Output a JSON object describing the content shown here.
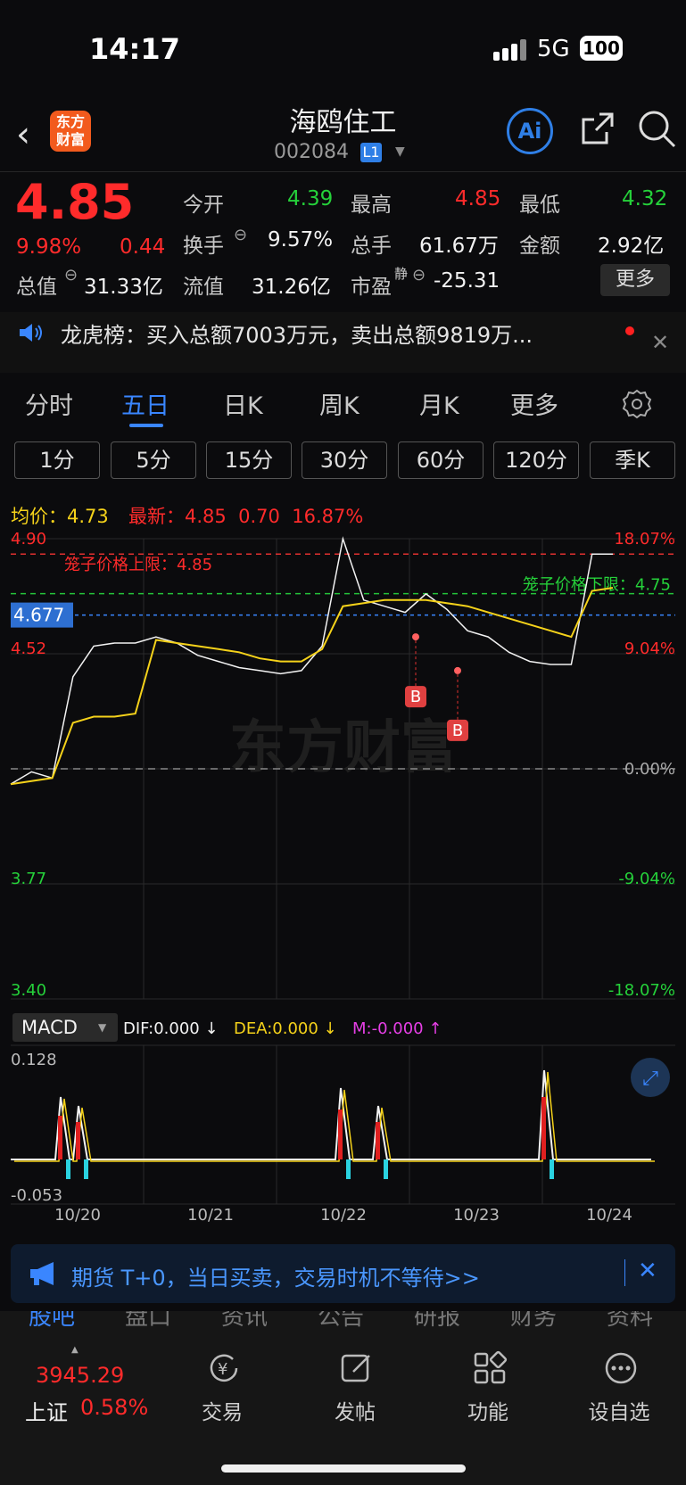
{
  "status_bar": {
    "time": "14:17",
    "network": "5G",
    "battery": "100"
  },
  "header": {
    "name": "海鸥住工",
    "code": "002084",
    "level_badge": "L1",
    "logo_text": "东方财富",
    "ai_label": "Ai"
  },
  "quote": {
    "price": "4.85",
    "change_pct": "9.98%",
    "change": "0.44",
    "open_label": "今开",
    "open": "4.39",
    "high_label": "最高",
    "high": "4.85",
    "low_label": "最低",
    "low": "4.32",
    "turnover_label": "换手",
    "turnover": "9.57%",
    "volume_label": "总手",
    "volume": "61.67万",
    "amount_label": "金额",
    "amount": "2.92亿",
    "mktcap_label": "总值",
    "mktcap": "31.33亿",
    "float_label": "流值",
    "float": "31.26亿",
    "pe_label": "市盈",
    "pe_sup": "静",
    "pe": "-25.31",
    "more_label": "更多"
  },
  "news": {
    "text": "龙虎榜：买入总额7003万元，卖出总额9819万..."
  },
  "tabs": {
    "t1": "分时",
    "t2": "五日",
    "t3": "日K",
    "t4": "周K",
    "t5": "月K",
    "t6": "更多",
    "active": "五日"
  },
  "periods": {
    "p1": "1分",
    "p2": "5分",
    "p3": "15分",
    "p4": "30分",
    "p5": "60分",
    "p6": "120分",
    "p7": "季K"
  },
  "chart_info": {
    "avg_label": "均价：",
    "avg": "4.73",
    "latest_label": "最新：",
    "latest": "4.85",
    "chg": "0.70",
    "chg_pct": "16.87%"
  },
  "cage": {
    "upper": "笼子价格上限：4.85",
    "lower": "笼子价格下限：4.75",
    "cursor": "4.677",
    "buy_marker": "B"
  },
  "watermark": "东方财富",
  "macd": {
    "label": "MACD",
    "dif": "DIF:0.000 ↓",
    "dea": "DEA:0.000 ↓",
    "m": "M:-0.000 ↑",
    "ymax": "0.128",
    "ymin": "-0.053"
  },
  "chart_data": {
    "type": "line",
    "x": [
      "10/20",
      "10/21",
      "10/22",
      "10/23",
      "10/24"
    ],
    "y_left_ticks": [
      "4.90",
      "4.52",
      "3.77",
      "3.40"
    ],
    "y_right_ticks": [
      "18.07%",
      "9.04%",
      "0.00%",
      "-9.04%",
      "-18.07%"
    ],
    "ylim": [
      3.4,
      4.9
    ],
    "series": [
      {
        "values": [
          4.1,
          4.14,
          4.12,
          4.45,
          4.55,
          4.56,
          4.56,
          4.58,
          4.56,
          4.52,
          4.5,
          4.48,
          4.47,
          4.46,
          4.47,
          4.55,
          4.9,
          4.7,
          4.68,
          4.66,
          4.72,
          4.67,
          4.6,
          4.58,
          4.53,
          4.5,
          4.49,
          4.49,
          4.85,
          4.85
        ]
      },
      {
        "values": [
          4.1,
          4.11,
          4.12,
          4.3,
          4.32,
          4.32,
          4.33,
          4.57,
          4.56,
          4.55,
          4.54,
          4.53,
          4.51,
          4.5,
          4.5,
          4.54,
          4.68,
          4.69,
          4.7,
          4.7,
          4.7,
          4.69,
          4.68,
          4.66,
          4.64,
          4.62,
          4.6,
          4.58,
          4.73,
          4.74
        ]
      }
    ]
  },
  "bottom_tabs": {
    "s1": "股吧",
    "s2": "盘口",
    "s3": "资讯",
    "s4": "公告",
    "s5": "研报",
    "s6": "财务",
    "s7": "资料"
  },
  "ad": {
    "text": "期货 T+0，当日买卖，交易时机不等待>>"
  },
  "bottom_nav": {
    "index_value": "3945.29",
    "index_name": "上证",
    "index_pct": "0.58%",
    "trade": "交易",
    "post": "发帖",
    "func": "功能",
    "watch": "设自选"
  }
}
